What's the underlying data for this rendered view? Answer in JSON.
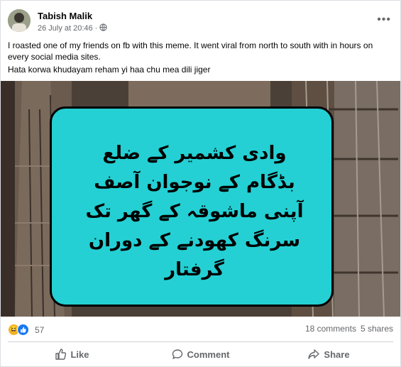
{
  "post": {
    "author": "Tabish Malik",
    "timestamp": "26 July at 20:46",
    "audience_icon": "globe-icon",
    "more_icon": "more-options-icon",
    "text_lines": [
      "I roasted one of my friends on fb with this meme. It went viral from north to south with in hours on every social media sites.",
      "Hata korwa khudayam reham yi haa chu mea dili jiger"
    ]
  },
  "meme": {
    "lines": [
      "وادی کشمیر کے ضلع",
      "بڈگام کے نوجوان آصف",
      "آپنی ماشوقہ کے گھر تک",
      "سرنگ کھودنے کے دوران",
      "گرفتار"
    ],
    "bubble_color": "#24d0d3"
  },
  "stats": {
    "reaction_count": "57",
    "reaction_icons": [
      "haha-icon",
      "like-icon"
    ],
    "comments": "18 comments",
    "shares": "5 shares"
  },
  "actions": {
    "like": "Like",
    "comment": "Comment",
    "share": "Share"
  },
  "colors": {
    "muted_text": "#65676b",
    "primary_text": "#050505",
    "like_blue": "#1877f2"
  }
}
